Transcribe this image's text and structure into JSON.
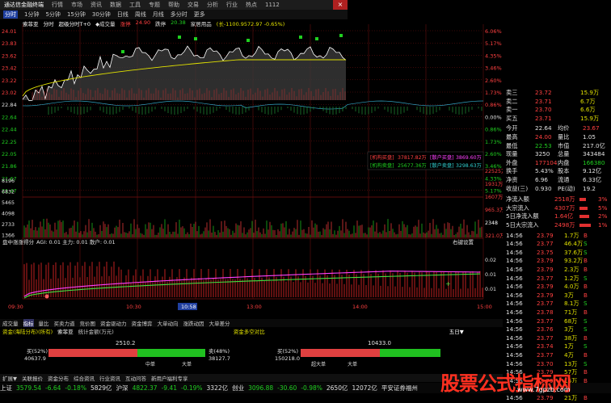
{
  "title_bar": {
    "app_name": "通达信金融终端",
    "menus": [
      "行情",
      "市场",
      "资讯",
      "数据",
      "工具",
      "专题",
      "帮助",
      "交易",
      "分析",
      "行业",
      "热点"
    ],
    "version": "1112",
    "close_label": "×"
  },
  "toolbar": {
    "periods": [
      "分时",
      "1分钟",
      "5分钟",
      "15分钟",
      "30分钟",
      "日线",
      "周线",
      "月线",
      "多分时",
      "更多"
    ]
  },
  "chart_info": {
    "stock": "索菲亚",
    "mode": "分时",
    "flags": "超级分时T+0",
    "items": [
      {
        "text": "◆成交量",
        "color": "#e0e0e0"
      },
      {
        "text": "涨停",
        "color": "#ff4040"
      },
      {
        "text": "24.90",
        "color": "#ff4040"
      },
      {
        "text": "跌停",
        "color": "#e0e0e0"
      },
      {
        "text": "20.38",
        "color": "#20d020"
      },
      {
        "text": "家居用品",
        "color": "#e0e0e0"
      },
      {
        "text": "(长-1100.9572.97 -0.65%)",
        "color": "#e0e000"
      }
    ]
  },
  "price_axis_left": [
    "24.01",
    "23.83",
    "23.62",
    "23.42",
    "23.22",
    "23.02",
    "22.84",
    "22.64",
    "22.44",
    "22.25",
    "22.05",
    "21.86",
    "21.67",
    "21.47"
  ],
  "pct_axis_right": [
    "6.06%",
    "5.17%",
    "4.35%",
    "3.46%",
    "2.60%",
    "1.73%",
    "0.86%",
    "0.00%",
    "0.86%",
    "1.73%",
    "2.60%",
    "3.46%",
    "4.33%",
    "5.17%"
  ],
  "volume_axis_left": [
    "8196",
    "6832",
    "5465",
    "4098",
    "2733",
    "1366"
  ],
  "volume_axis_right": [
    "22525万",
    "1931万",
    "1607万",
    "965.3万",
    "2348",
    "321.0万"
  ],
  "fund_flow": {
    "inst_buy_label": "[机构买盘]",
    "inst_buy": "37817.82万",
    "retail_buy_label": "[散户买盘]",
    "retail_buy": "3869.60万",
    "inst_sell_label": "[机构卖盘]",
    "inst_sell": "25677.36万",
    "retail_sell_label": "[散户卖盘]",
    "retail_sell": "3298.63万"
  },
  "indicator": {
    "label": "盘中涨涨得分",
    "values": "AGI: 0.01  主力: 0.01  散户: 0.01",
    "right_label": "右键设置",
    "axis": [
      "0.02",
      "0.01",
      "0.01"
    ]
  },
  "time_axis": [
    "09:30",
    "10:30",
    "10:58",
    "13:00",
    "14:00",
    "15:00"
  ],
  "right_panel": {
    "orders": [
      {
        "label": "卖三",
        "price": "23.72",
        "vol": "15.9万",
        "pcolor": "red"
      },
      {
        "label": "卖二",
        "price": "23.71",
        "vol": "6.7万",
        "pcolor": "red"
      },
      {
        "label": "卖一",
        "price": "23.70",
        "vol": "6.6万",
        "pcolor": "red"
      },
      {
        "label": "买五",
        "price": "23.71",
        "vol": "15.9万",
        "pcolor": "red"
      }
    ],
    "stats": [
      {
        "l1": "今开",
        "v1": "22.64",
        "c1": "wht",
        "l2": "均价",
        "v2": "23.67",
        "c2": "red"
      },
      {
        "l1": "最高",
        "v1": "24.00",
        "c1": "red",
        "l2": "量比",
        "v2": "1.05",
        "c2": "wht"
      },
      {
        "l1": "最低",
        "v1": "22.53",
        "c1": "green",
        "l2": "市值",
        "v2": "217.0亿",
        "c2": "wht"
      },
      {
        "l1": "现量",
        "v1": "3250",
        "c1": "wht",
        "l2": "总量",
        "v2": "343484",
        "c2": "wht"
      },
      {
        "l1": "外盘",
        "v1": "177104",
        "c1": "red",
        "l2": "内盘",
        "v2": "166380",
        "c2": "green"
      },
      {
        "l1": "换手",
        "v1": "5.43%",
        "c1": "wht",
        "l2": "股本",
        "v2": "9.12亿",
        "c2": "wht"
      },
      {
        "l1": "净资",
        "v1": "6.96",
        "c1": "wht",
        "l2": "流通",
        "v2": "6.33亿",
        "c2": "wht"
      },
      {
        "l1": "收益(三)",
        "v1": "0.930",
        "c1": "wht",
        "l2": "PE(动)",
        "v2": "19.2",
        "c2": "wht"
      }
    ],
    "flows": [
      {
        "label": "净流入额",
        "value": "2518万",
        "pct": "3%"
      },
      {
        "label": "大宗流入",
        "value": "4307万",
        "pct": "5%"
      },
      {
        "label": "5日净流入额",
        "value": "1.64亿",
        "pct": "2%"
      },
      {
        "label": "5日大宗流入",
        "value": "2498万",
        "pct": "1%"
      }
    ],
    "ticks": [
      {
        "time": "14:56",
        "price": "23.79",
        "vol": "1.7万",
        "dir": "B"
      },
      {
        "time": "14:56",
        "price": "23.77",
        "vol": "46.4万",
        "dir": "S"
      },
      {
        "time": "14:56",
        "price": "23.75",
        "vol": "37.6万",
        "dir": "S"
      },
      {
        "time": "14:56",
        "price": "23.79",
        "vol": "93.2万",
        "dir": "B"
      },
      {
        "time": "14:56",
        "price": "23.79",
        "vol": "2.3万",
        "dir": "B"
      },
      {
        "time": "14:56",
        "price": "23.77",
        "vol": "1.2万",
        "dir": "S"
      },
      {
        "time": "14:56",
        "price": "23.79",
        "vol": "4.0万",
        "dir": "B"
      },
      {
        "time": "14:56",
        "price": "23.79",
        "vol": "3万",
        "dir": "B"
      },
      {
        "time": "14:56",
        "price": "23.77",
        "vol": "8.1万",
        "dir": "S"
      },
      {
        "time": "14:56",
        "price": "23.78",
        "vol": "71万",
        "dir": "B"
      },
      {
        "time": "14:56",
        "price": "23.77",
        "vol": "68万",
        "dir": "S"
      },
      {
        "time": "14:56",
        "price": "23.76",
        "vol": "3万",
        "dir": "S"
      },
      {
        "time": "14:56",
        "price": "23.77",
        "vol": "38万",
        "dir": "B"
      },
      {
        "time": "14:56",
        "price": "23.74",
        "vol": "1万",
        "dir": "S"
      },
      {
        "time": "14:56",
        "price": "23.77",
        "vol": "4万",
        "dir": "B"
      },
      {
        "time": "14:56",
        "price": "23.70",
        "vol": "13万",
        "dir": "S"
      },
      {
        "time": "14:56",
        "price": "23.79",
        "vol": "57万",
        "dir": "B"
      },
      {
        "time": "14:56",
        "price": "23.79",
        "vol": "15万",
        "dir": "B"
      },
      {
        "time": "14:56",
        "price": "23.79",
        "vol": "34万",
        "dir": "B"
      },
      {
        "time": "14:56",
        "price": "23.79",
        "vol": "21万",
        "dir": "B"
      }
    ]
  },
  "bottom_tabs": [
    "成交量",
    "指标",
    "量比",
    "买卖力道",
    "竞价图",
    "资金驱动力",
    "资金博弈",
    "大单动向",
    "涨跌动因",
    "大单差分"
  ],
  "sub_tabs_left": [
    "资金(海陆分布)(所有)",
    "索菲亚",
    "统计金额(万元)"
  ],
  "sub_tabs_right": [
    "资金多空对比",
    "五日▼"
  ],
  "balance_left": {
    "buy_pct": "买(52%)",
    "buy_val": "40637.9",
    "center": "2510.2",
    "sell_pct": "卖(48%)",
    "sell_val": "38127.7",
    "mid1": "中单",
    "mid2": "大单"
  },
  "balance_right": {
    "buy_pct": "买(52%)",
    "buy_val": "150218.0",
    "center": "10433.0",
    "mid1": "超大单",
    "mid2": "大单"
  },
  "bottom_nav": [
    "扩展▼",
    "关联报价",
    "资金分布",
    "综合资讯",
    "行业资讯",
    "互动问答",
    "新用户福利专享"
  ],
  "status_bar": [
    {
      "text": "上证",
      "color": "#e0e0e0"
    },
    {
      "text": "3579.54",
      "color": "#20d020"
    },
    {
      "text": "-6.64",
      "color": "#20d020"
    },
    {
      "text": "-0.18%",
      "color": "#20d020"
    },
    {
      "text": "5829亿",
      "color": "#e0e0e0"
    },
    {
      "text": "沪深",
      "color": "#e0e0e0"
    },
    {
      "text": "4822.37",
      "color": "#20d020"
    },
    {
      "text": "-9.41",
      "color": "#20d020"
    },
    {
      "text": "-0.19%",
      "color": "#20d020"
    },
    {
      "text": "3322亿",
      "color": "#e0e0e0"
    },
    {
      "text": "创业",
      "color": "#e0e0e0"
    },
    {
      "text": "3096.88",
      "color": "#20d020"
    },
    {
      "text": "-30.60",
      "color": "#20d020"
    },
    {
      "text": "-0.98%",
      "color": "#20d020"
    },
    {
      "text": "2650亿",
      "color": "#e0e0e0"
    },
    {
      "text": "12072亿",
      "color": "#e0e0e0"
    },
    {
      "text": "平安证券福州",
      "color": "#e0e0e0"
    }
  ],
  "watermark": {
    "text": "股票公式指标网",
    "url": "www.7gpzb.com"
  },
  "colors": {
    "up": "#ff4040",
    "down": "#20d020",
    "price_line": "#ffffff",
    "avg_line": "#e0e000",
    "grid": "#7a1010"
  }
}
